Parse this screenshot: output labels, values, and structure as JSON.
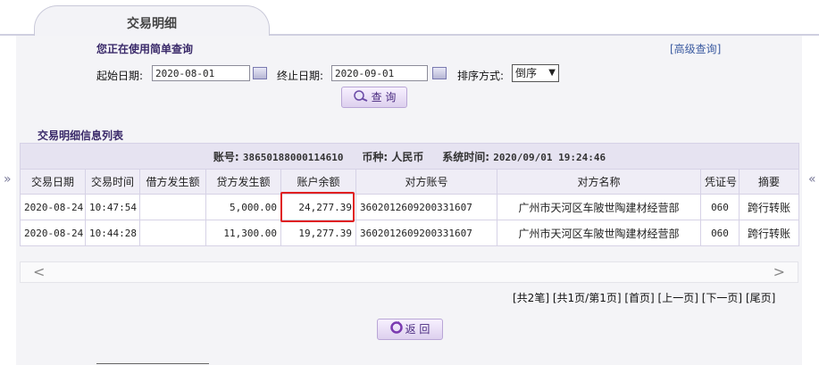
{
  "tab": {
    "title": "交易明细"
  },
  "query": {
    "mode_text": "您正在使用简单查询",
    "advanced_link": "[高级查询]",
    "start_label": "起始日期:",
    "start_value": "2020-08-01",
    "end_label": "终止日期:",
    "end_value": "2020-09-01",
    "sort_label": "排序方式:",
    "sort_value": "倒序",
    "search_button": "查 询"
  },
  "list": {
    "title": "交易明细信息列表",
    "account_info": {
      "account_label": "账号:",
      "account_value": "38650188000114610",
      "currency_label": "币种:",
      "currency_value": "人民币",
      "systime_label": "系统时间:",
      "systime_value": "2020/09/01 19:24:46"
    },
    "columns": [
      "交易日期",
      "交易时间",
      "借方发生额",
      "贷方发生额",
      "账户余额",
      "对方账号",
      "对方名称",
      "凭证号",
      "摘要"
    ],
    "rows": [
      [
        "2020-08-24",
        "10:47:54",
        "",
        "5,000.00",
        "24,277.39",
        "3602012609200331607",
        "广州市天河区车陂世陶建材经营部",
        "060",
        "跨行转账"
      ],
      [
        "2020-08-24",
        "10:44:28",
        "",
        "11,300.00",
        "19,277.39",
        "3602012609200331607",
        "广州市天河区车陂世陶建材经营部",
        "060",
        "跨行转账"
      ]
    ]
  },
  "scroll": {
    "left": "<",
    "right": ">"
  },
  "pager": {
    "total": "[共2笔]",
    "pages": "[共1页/第1页]",
    "first": "[首页]",
    "prev": "[上一页]",
    "next": "[下一页]",
    "last": "[尾页]"
  },
  "back_button": "返 回",
  "side": {
    "left": "»",
    "right": "«"
  }
}
